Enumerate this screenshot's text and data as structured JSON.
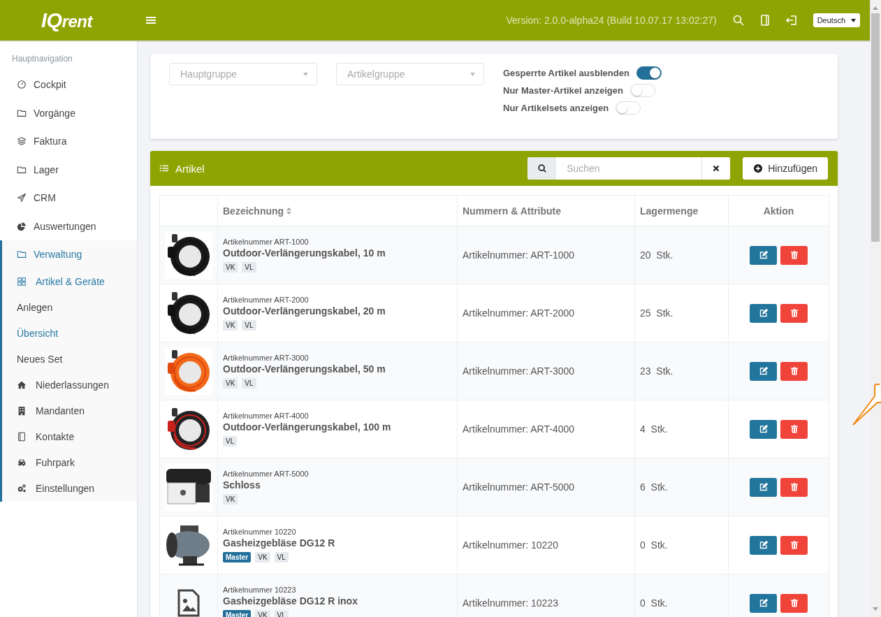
{
  "header": {
    "logo": {
      "strong": "IQ",
      "rest": "rent"
    },
    "version": "Version: 2.0.0-alpha24 (Build 10.07.17 13:02:27)",
    "language": "Deutsch"
  },
  "sidebar": {
    "heading": "Hauptnavigation",
    "items": [
      {
        "label": "Cockpit",
        "selected": false
      },
      {
        "label": "Vorgänge",
        "selected": false
      },
      {
        "label": "Faktura",
        "selected": false
      },
      {
        "label": "Lager",
        "selected": false
      },
      {
        "label": "CRM",
        "selected": false
      },
      {
        "label": "Auswertungen",
        "selected": false
      },
      {
        "label": "Verwaltung",
        "selected": true,
        "expanded": true,
        "children": [
          {
            "label": "Artikel & Geräte",
            "selected": true,
            "children": [
              {
                "label": "Anlegen",
                "selected": false
              },
              {
                "label": "Übersicht",
                "selected": true
              },
              {
                "label": "Neues Set",
                "selected": false
              }
            ]
          },
          {
            "label": "Niederlassungen",
            "selected": false
          },
          {
            "label": "Mandanten",
            "selected": false
          },
          {
            "label": "Kontakte",
            "selected": false
          },
          {
            "label": "Fuhrpark",
            "selected": false
          },
          {
            "label": "Einstellungen",
            "selected": false
          }
        ]
      }
    ]
  },
  "filters": {
    "selects": [
      {
        "placeholder": "Hauptgruppe"
      },
      {
        "placeholder": "Artikelgruppe"
      }
    ],
    "toggles": [
      {
        "label": "Gesperrte Artikel ausblenden",
        "on": true
      },
      {
        "label": "Nur Master-Artikel anzeigen",
        "on": false
      },
      {
        "label": "Nur Artikelsets anzeigen",
        "on": false
      }
    ]
  },
  "articles": {
    "title": "Artikel",
    "search": {
      "placeholder": "Suchen"
    },
    "add_button": "Hinzufügen",
    "columns": [
      {
        "label": "Bezeichnung",
        "sortable": true
      },
      {
        "label": "Nummern & Attribute",
        "sortable": false
      },
      {
        "label": "Lagermenge",
        "sortable": false
      },
      {
        "label": "Aktion",
        "sortable": false
      }
    ],
    "rows": [
      {
        "image": {
          "kind": "picture"
        },
        "number": "Artikelnummer ART-1000",
        "name": "Outdoor-Verlängerungskabel, 10 m",
        "tags": [
          {
            "label": "VK",
            "kind": "plain"
          },
          {
            "label": "VL",
            "kind": "plain"
          }
        ],
        "attributes": "Artikelnummer: ART-1000",
        "stock": "20  Stk."
      },
      {
        "image": {
          "kind": "picture"
        },
        "number": "Artikelnummer ART-2000",
        "name": "Outdoor-Verlängerungskabel, 20 m",
        "tags": [
          {
            "label": "VK",
            "kind": "plain"
          },
          {
            "label": "VL",
            "kind": "plain"
          }
        ],
        "attributes": "Artikelnummer: ART-2000",
        "stock": "25  Stk."
      },
      {
        "image": {
          "kind": "picture"
        },
        "number": "Artikelnummer ART-3000",
        "name": "Outdoor-Verlängerungskabel, 50 m",
        "tags": [
          {
            "label": "VK",
            "kind": "plain"
          },
          {
            "label": "VL",
            "kind": "plain"
          }
        ],
        "attributes": "Artikelnummer: ART-3000",
        "stock": "23  Stk."
      },
      {
        "image": {
          "kind": "picture"
        },
        "number": "Artikelnummer ART-4000",
        "name": "Outdoor-Verlängerungskabel, 100 m",
        "tags": [
          {
            "label": "VL",
            "kind": "plain"
          }
        ],
        "attributes": "Artikelnummer: ART-4000",
        "stock": "4  Stk."
      },
      {
        "image": {
          "kind": "picture"
        },
        "number": "Artikelnummer ART-5000",
        "name": "Schloss",
        "tags": [
          {
            "label": "VK",
            "kind": "plain"
          }
        ],
        "attributes": "Artikelnummer: ART-5000",
        "stock": "6  Stk."
      },
      {
        "image": {
          "kind": "picture"
        },
        "number": "Artikelnummer 10220",
        "name": "Gasheizgebläse DG12 R",
        "tags": [
          {
            "label": "Master",
            "kind": "master"
          },
          {
            "label": "VK",
            "kind": "plain"
          },
          {
            "label": "VL",
            "kind": "plain"
          }
        ],
        "attributes": "Artikelnummer: 10220",
        "stock": "0  Stk."
      },
      {
        "image": {
          "kind": "placeholder"
        },
        "number": "Artikelnummer 10223",
        "name": "Gasheizgebläse DG12 R inox",
        "tags": [
          {
            "label": "Master",
            "kind": "master"
          },
          {
            "label": "VK",
            "kind": "plain"
          },
          {
            "label": "VL",
            "kind": "plain"
          }
        ],
        "attributes": "Artikelnummer: 10223",
        "stock": "0  Stk."
      }
    ]
  }
}
